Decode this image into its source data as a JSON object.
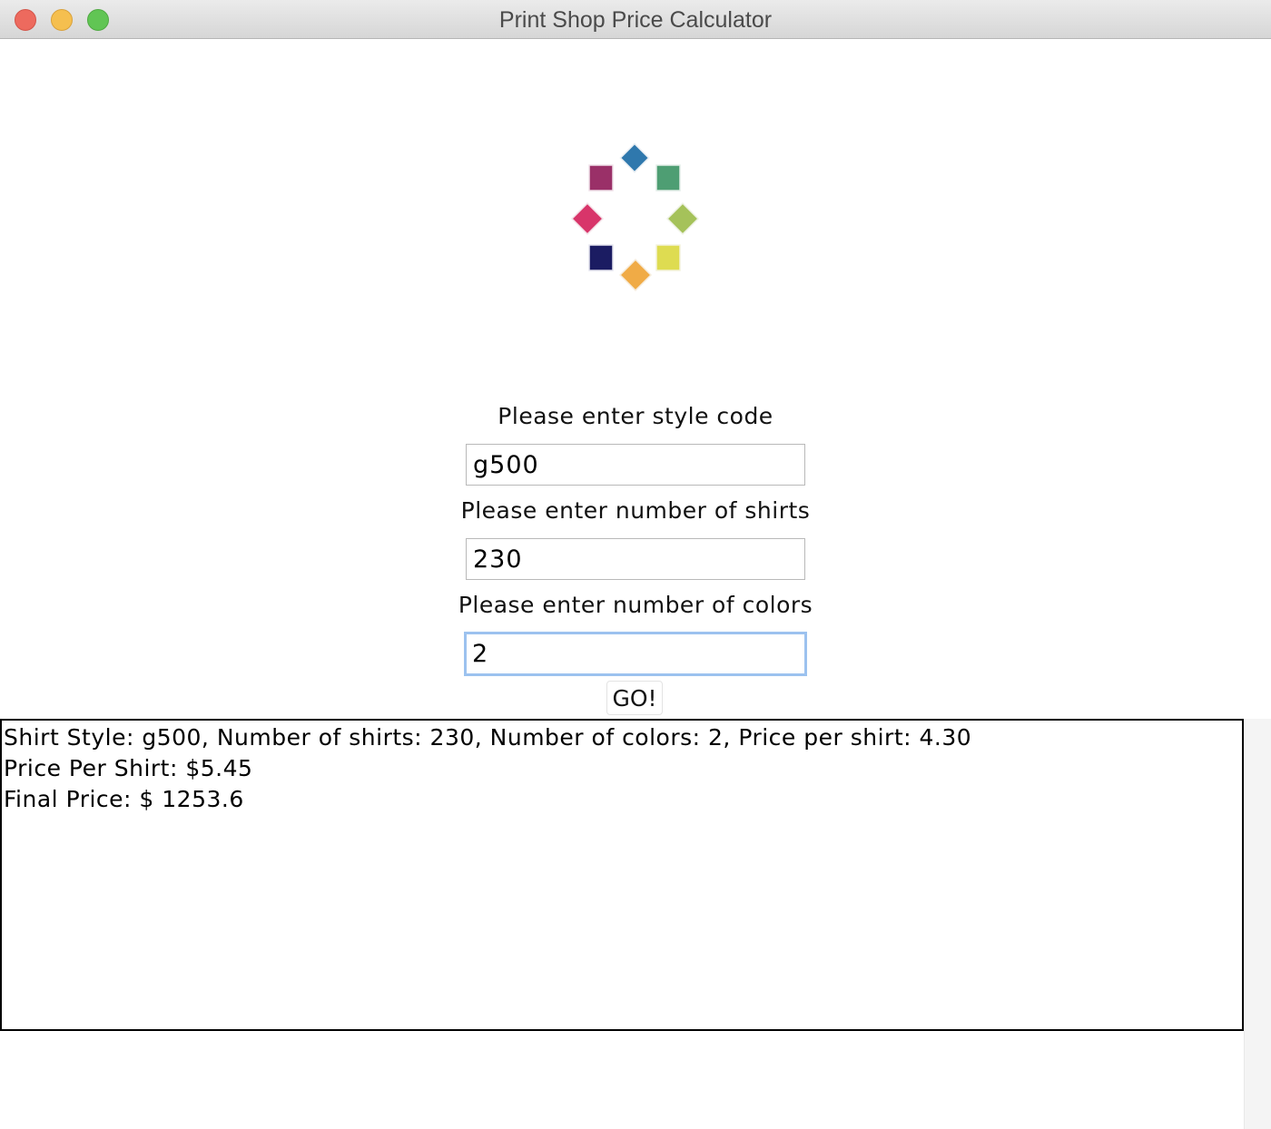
{
  "window": {
    "title": "Print Shop Price Calculator"
  },
  "form": {
    "style_label": "Please enter style code",
    "style_value": "g500",
    "shirts_label": "Please enter number of shirts",
    "shirts_value": "230",
    "colors_label": "Please enter number of colors",
    "colors_value": "2",
    "go_label": "GO!"
  },
  "output": {
    "lines": [
      "Shirt Style: g500, Number of shirts: 230, Number of colors: 2, Price per shirt: 4.30",
      "Price Per Shirt: $5.45",
      "Final Price: $ 1253.6"
    ]
  },
  "logo": {
    "icon": "color-swatch-ring-logo",
    "colors": [
      "#2f78ad",
      "#4e9e73",
      "#a5c25a",
      "#dedc51",
      "#f0ab46",
      "#1b1c62",
      "#d8356a",
      "#9a3068"
    ]
  }
}
